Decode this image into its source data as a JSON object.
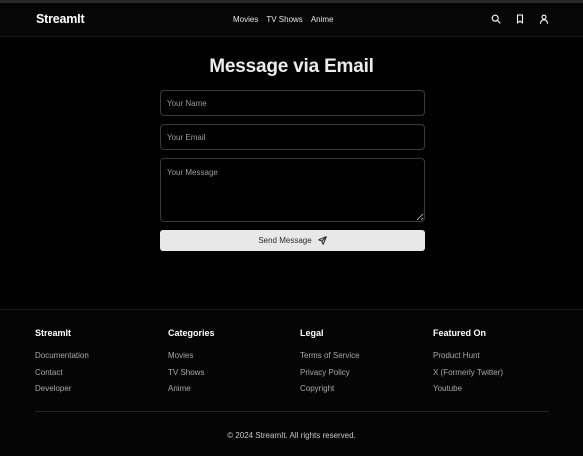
{
  "header": {
    "logo": "StreamIt",
    "nav": [
      "Movies",
      "TV Shows",
      "Anime"
    ],
    "icons": [
      "search-icon",
      "bookmark-icon",
      "user-icon"
    ]
  },
  "form": {
    "title": "Message via Email",
    "name_placeholder": "Your Name",
    "email_placeholder": "Your Email",
    "message_placeholder": "Your Message",
    "send_label": "Send Message",
    "send_icon": "send-icon"
  },
  "footer": {
    "columns": [
      {
        "heading": "StreamIt",
        "links": [
          "Documentation",
          "Contact",
          "Developer"
        ]
      },
      {
        "heading": "Categories",
        "links": [
          "Movies",
          "TV Shows",
          "Anime"
        ]
      },
      {
        "heading": "Legal",
        "links": [
          "Terms of Service",
          "Privacy Policy",
          "Copyright"
        ]
      },
      {
        "heading": "Featured On",
        "links": [
          "Product Hunt",
          "X (Formerly Twitter)",
          "Youtube"
        ]
      }
    ],
    "copyright": "© 2024 StreamIt. All rights reserved."
  },
  "colors": {
    "background": "#000000",
    "button_bg": "#e8e8e8",
    "muted_text": "#a8a8a8"
  }
}
